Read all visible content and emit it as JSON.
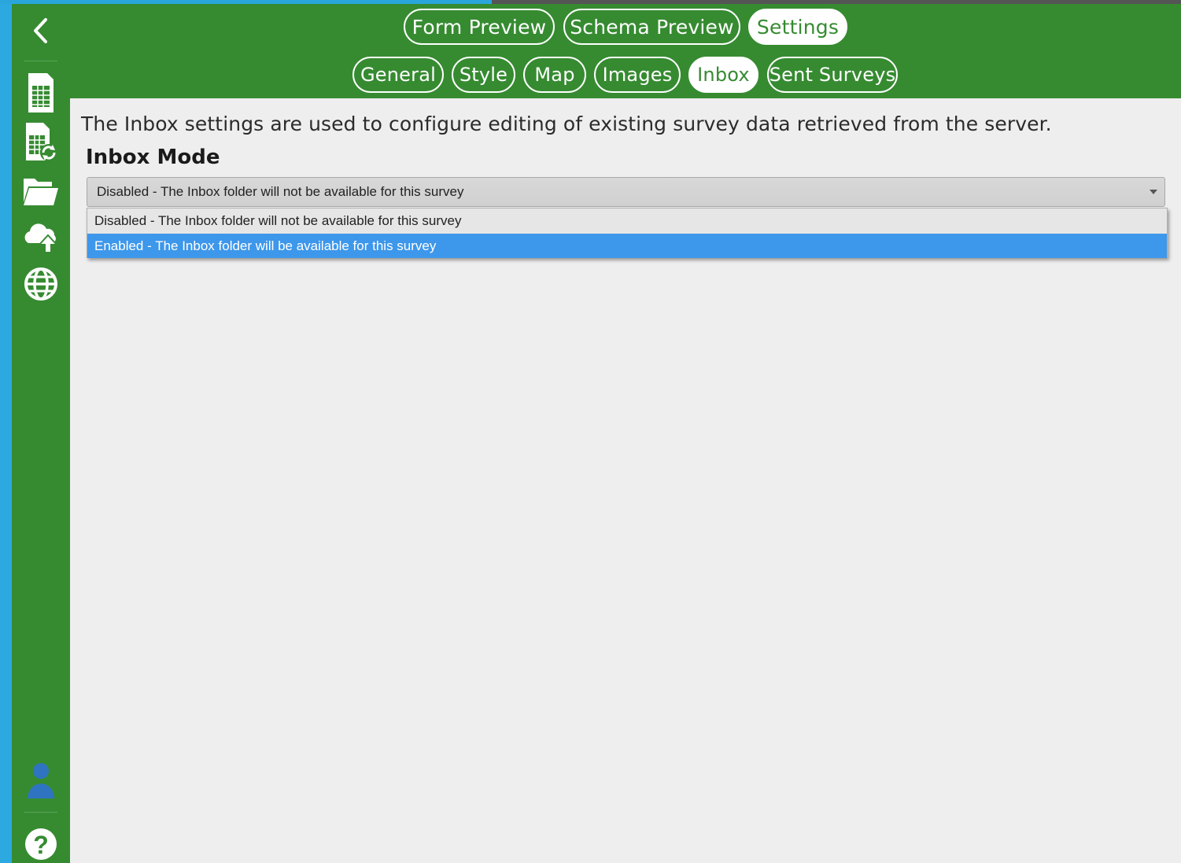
{
  "tabs": [
    {
      "label": "Form Preview",
      "active": false
    },
    {
      "label": "Schema Preview",
      "active": false
    },
    {
      "label": "Settings",
      "active": true
    }
  ],
  "subtabs": [
    {
      "label": "General",
      "active": false
    },
    {
      "label": "Style",
      "active": false
    },
    {
      "label": "Map",
      "active": false
    },
    {
      "label": "Images",
      "active": false
    },
    {
      "label": "Inbox",
      "active": true
    },
    {
      "label": "Sent Surveys",
      "active": false
    }
  ],
  "sidebar": {
    "items": [
      "back-icon",
      "spreadsheet-icon",
      "spreadsheet-refresh-icon",
      "folder-icon",
      "cloud-upload-icon",
      "globe-icon",
      "user-icon",
      "help-icon"
    ]
  },
  "content": {
    "description": "The Inbox settings are used to configure editing of existing survey data retrieved from the server.",
    "field_label": "Inbox Mode",
    "select_value": "Disabled - The Inbox folder will not be available for this survey",
    "options": [
      "Disabled - The Inbox folder will not be available for this survey",
      "Enabled - The Inbox folder will be available for this survey"
    ],
    "highlighted_option": "Enabled - The Inbox folder will be available for this survey"
  },
  "colors": {
    "header_green": "#368b31",
    "background": "#eeeeee",
    "highlight_blue": "#3d97ea",
    "user_icon_blue": "#2f74c0"
  }
}
